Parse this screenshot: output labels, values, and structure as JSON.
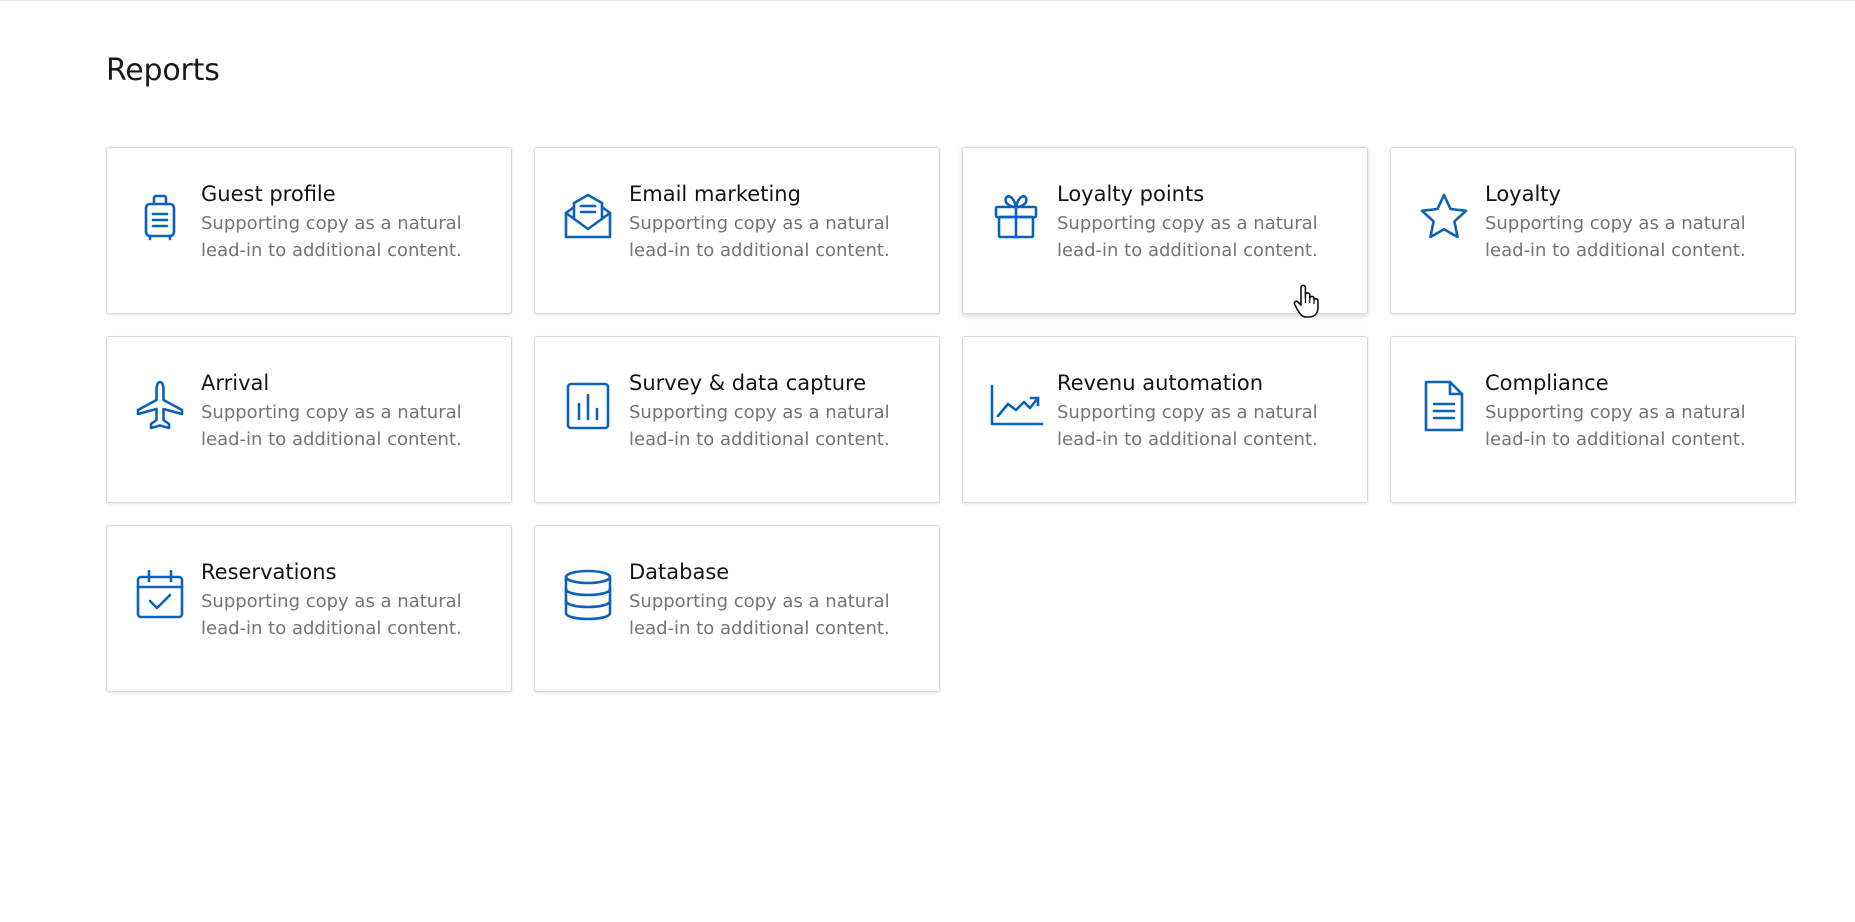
{
  "page": {
    "title": "Reports"
  },
  "cards": [
    {
      "icon": "luggage-icon",
      "title": "Guest profile",
      "description": "Supporting copy as a natural lead-in to additional content."
    },
    {
      "icon": "envelope-open-icon",
      "title": "Email marketing",
      "description": "Supporting copy as a natural lead-in to additional content."
    },
    {
      "icon": "gift-icon",
      "title": "Loyalty points",
      "description": "Supporting copy as a natural lead-in to additional content."
    },
    {
      "icon": "star-icon",
      "title": "Loyalty",
      "description": "Supporting copy as a natural lead-in to additional content."
    },
    {
      "icon": "airplane-icon",
      "title": "Arrival",
      "description": "Supporting copy as a natural lead-in to additional content."
    },
    {
      "icon": "bar-chart-icon",
      "title": "Survey & data capture",
      "description": "Supporting copy as a natural lead-in to additional content."
    },
    {
      "icon": "trend-chart-icon",
      "title": "Revenu automation",
      "description": "Supporting copy as a natural lead-in to additional content."
    },
    {
      "icon": "document-icon",
      "title": "Compliance",
      "description": "Supporting copy as a natural lead-in to additional content."
    },
    {
      "icon": "calendar-check-icon",
      "title": "Reservations",
      "description": "Supporting copy as a natural lead-in to additional content."
    },
    {
      "icon": "database-icon",
      "title": "Database",
      "description": "Supporting copy as a natural lead-in to additional content."
    }
  ],
  "colors": {
    "accent": "#0b62b8",
    "title_text": "#141414",
    "body_text": "#747474",
    "card_border": "#d9d9d9"
  },
  "cursor": {
    "icon": "hand-pointer-icon"
  }
}
